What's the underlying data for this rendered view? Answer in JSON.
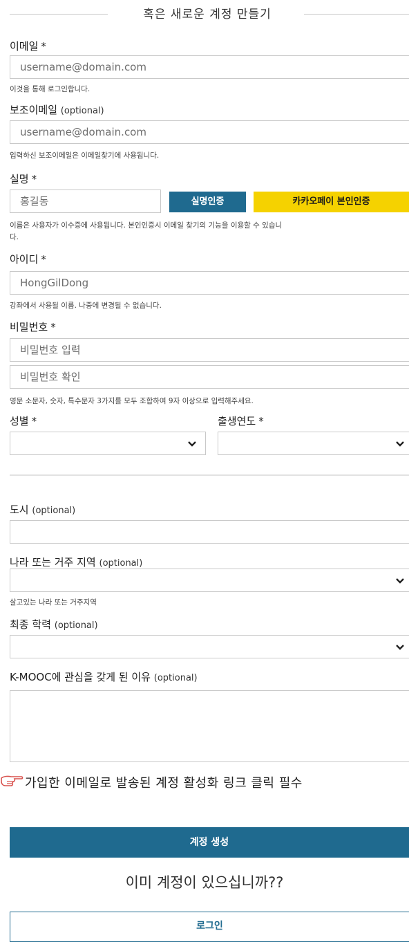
{
  "header": {
    "title": "혹은 새로운 계정 만들기"
  },
  "email": {
    "label": "이메일",
    "required_mark": "*",
    "placeholder": "username@domain.com",
    "help": "이것을 통해 로그인합니다."
  },
  "secondary_email": {
    "label": "보조이메일",
    "optional": "(optional)",
    "placeholder": "username@domain.com",
    "help": "입력하신 보조이메일은 이메일찾기에 사용됩니다."
  },
  "name": {
    "label": "실명",
    "required_mark": "*",
    "placeholder": "홍길동",
    "verify_button": "실명인증",
    "kakao_button": "카카오페이 본인인증",
    "help_line1": "이름은 사용자가 이수증에 사용됩니다. 본인인증시 이메일 찾기의 기능을 이용할 수 있습니",
    "help_line2": "다."
  },
  "username": {
    "label": "아이디",
    "required_mark": "*",
    "placeholder": "HongGilDong",
    "help": "강좌에서 사용될 이름. 나중에 변경될 수 없습니다."
  },
  "password": {
    "label": "비밀번호",
    "required_mark": "*",
    "placeholder": "비밀번호 입력",
    "confirm_placeholder": "비밀번호 확인",
    "help": "영문 소문자, 숫자, 특수문자 3가지를 모두 조합하여 9자 이상으로 입력해주세요."
  },
  "gender": {
    "label": "성별",
    "required_mark": "*",
    "value": ""
  },
  "birth_year": {
    "label": "출생연도",
    "required_mark": "*",
    "value": ""
  },
  "city": {
    "label": "도시",
    "optional": "(optional)",
    "value": ""
  },
  "country": {
    "label": "나라 또는 거주 지역",
    "optional": "(optional)",
    "value": "",
    "help": "살고있는 나라 또는 거주지역"
  },
  "education": {
    "label": "최종 학력",
    "optional": "(optional)",
    "value": ""
  },
  "reason": {
    "label": "K-MOOC에 관심을 갖게 된 이유",
    "optional": "(optional)",
    "value": ""
  },
  "notice": {
    "icon": "pointing-hand-icon",
    "text": "가입한 이메일로 발송된 계정 활성화 링크 클릭 필수"
  },
  "submit": {
    "label": "계정 생성"
  },
  "login_prompt": {
    "text": "이미 계정이 있으십니까??"
  },
  "login": {
    "label": "로그인"
  },
  "colors": {
    "primary_blue": "#1f6a8f",
    "kakao_yellow": "#f5d200",
    "border": "#c9c9c9",
    "notice_icon": "#d9534f"
  }
}
